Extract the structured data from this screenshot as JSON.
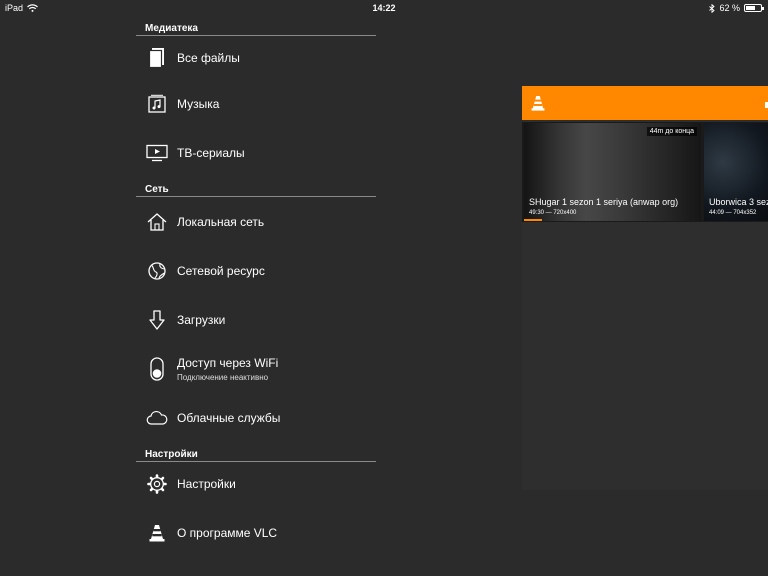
{
  "status_bar": {
    "carrier": "iPad",
    "time": "14:22",
    "battery_text": "62 %",
    "battery_level": 0.62
  },
  "menu": {
    "sections": [
      {
        "header": "Медиатека",
        "items": [
          {
            "label": "Все файлы",
            "icon": "all-files-icon"
          },
          {
            "label": "Музыка",
            "icon": "music-icon"
          },
          {
            "label": "ТВ-сериалы",
            "icon": "tv-icon"
          }
        ]
      },
      {
        "header": "Сеть",
        "items": [
          {
            "label": "Локальная сеть",
            "icon": "home-icon"
          },
          {
            "label": "Сетевой ресурс",
            "icon": "globe-icon"
          },
          {
            "label": "Загрузки",
            "icon": "download-icon"
          },
          {
            "label": "Доступ через WiFi",
            "sublabel": "Подключение неактивно",
            "icon": "toggle-icon"
          },
          {
            "label": "Облачные службы",
            "icon": "cloud-icon"
          }
        ]
      },
      {
        "header": "Настройки",
        "items": [
          {
            "label": "Настройки",
            "icon": "gear-icon"
          },
          {
            "label": "О программе VLC",
            "icon": "vlc-cone-icon"
          }
        ]
      }
    ]
  },
  "library": {
    "accent": "#ff8800",
    "videos": [
      {
        "title": "SHugar 1 sezon 1 seriya (anwap org)",
        "meta": "49:30 — 720x400",
        "badge": "44m до конца",
        "progress": 0.1
      },
      {
        "title": "Uborwica 3 sez",
        "meta": "44:09 — 704x352",
        "progress": 0
      }
    ]
  }
}
